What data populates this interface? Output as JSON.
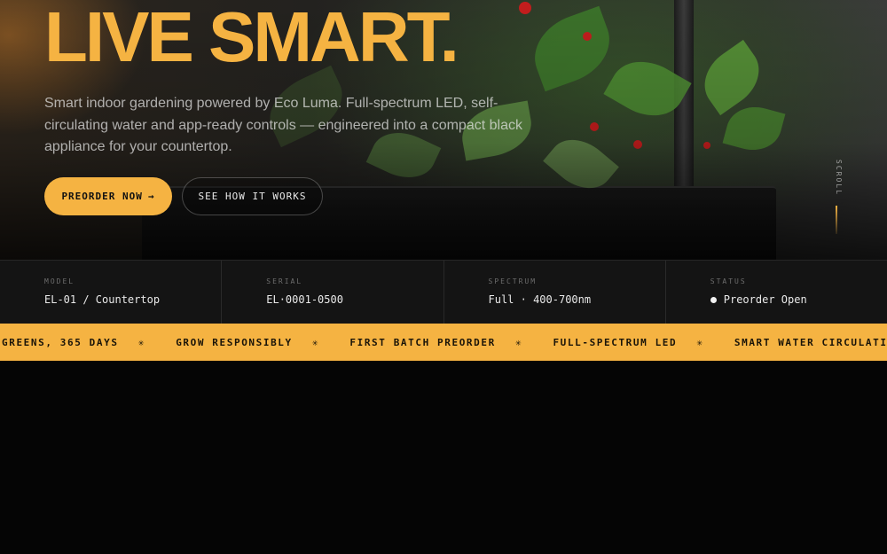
{
  "hero": {
    "title": "LIVE SMART.",
    "description": "Smart indoor gardening powered by Eco Luma. Full-spectrum LED, self-circulating water and app-ready controls — engineered into a compact black appliance for your countertop.",
    "primary_button": "PREORDER NOW",
    "primary_button_icon": "→",
    "secondary_button": "SEE HOW IT WORKS",
    "scroll_label": "SCROLL"
  },
  "specs": [
    {
      "label": "MODEL",
      "value": "EL-01 / Countertop"
    },
    {
      "label": "SERIAL",
      "value": "EL·0001-0500"
    },
    {
      "label": "SPECTRUM",
      "value": "Full · 400-700nm"
    },
    {
      "label": "STATUS",
      "value": "Preorder Open"
    }
  ],
  "marquee": {
    "items": [
      "GREENS, 365 DAYS",
      "GROW RESPONSIBLY",
      "FIRST BATCH PREORDER",
      "FULL-SPECTRUM LED",
      "SMART WATER CIRCULATION"
    ],
    "separator": "✳"
  },
  "colors": {
    "accent": "#f5b342",
    "background": "#050505",
    "spec_bar": "#141414"
  }
}
